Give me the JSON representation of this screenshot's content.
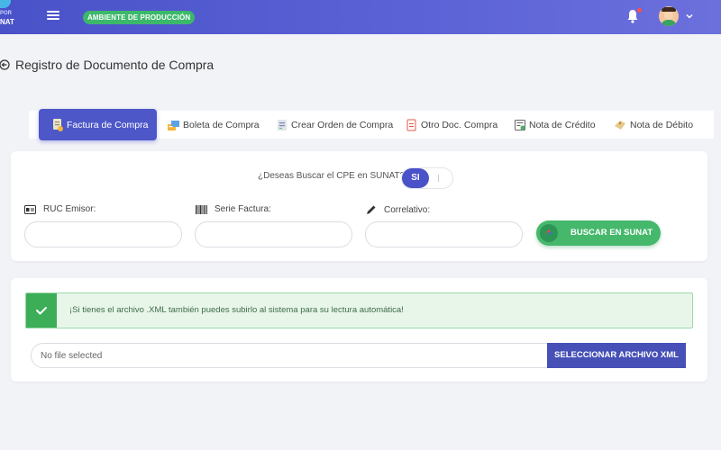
{
  "header": {
    "logo_line1": "POR",
    "logo_line2": "NAT",
    "env_badge": "AMBIENTE DE PRODUCCIÓN",
    "colors": {
      "bar": "#4a52c9",
      "badge": "#3cb86a",
      "notification_dot": "#ff4d4d"
    }
  },
  "page": {
    "title": "Registro de Documento de Compra"
  },
  "tabs": [
    {
      "label": "Factura de Compra",
      "icon": "invoice-icon",
      "active": true
    },
    {
      "label": "Boleta de Compra",
      "icon": "receipt-icon"
    },
    {
      "label": "Crear Orden de Compra",
      "icon": "order-icon"
    },
    {
      "label": "Otro Doc. Compra",
      "icon": "document-icon"
    },
    {
      "label": "Nota de Crédito",
      "icon": "credit-note-icon"
    },
    {
      "label": "Nota de Débito",
      "icon": "debit-note-icon"
    }
  ],
  "search": {
    "question": "¿Deseas Buscar el CPE en SUNAT?",
    "toggle_label": "SI",
    "fields": [
      {
        "label": "RUC Emisor:",
        "icon": "id-card-icon",
        "value": ""
      },
      {
        "label": "Serie Factura:",
        "icon": "barcode-icon",
        "value": ""
      },
      {
        "label": "Correlativo:",
        "icon": "pencil-icon",
        "value": ""
      }
    ],
    "button_label": "BUSCAR EN SUNAT"
  },
  "upload": {
    "alert_text": "¡Si tienes el archivo .XML también puedes subirlo al sistema para su lectura automática!",
    "file_text": "No file selected",
    "button_label": "SELECCIONAR ARCHIVO XML"
  }
}
